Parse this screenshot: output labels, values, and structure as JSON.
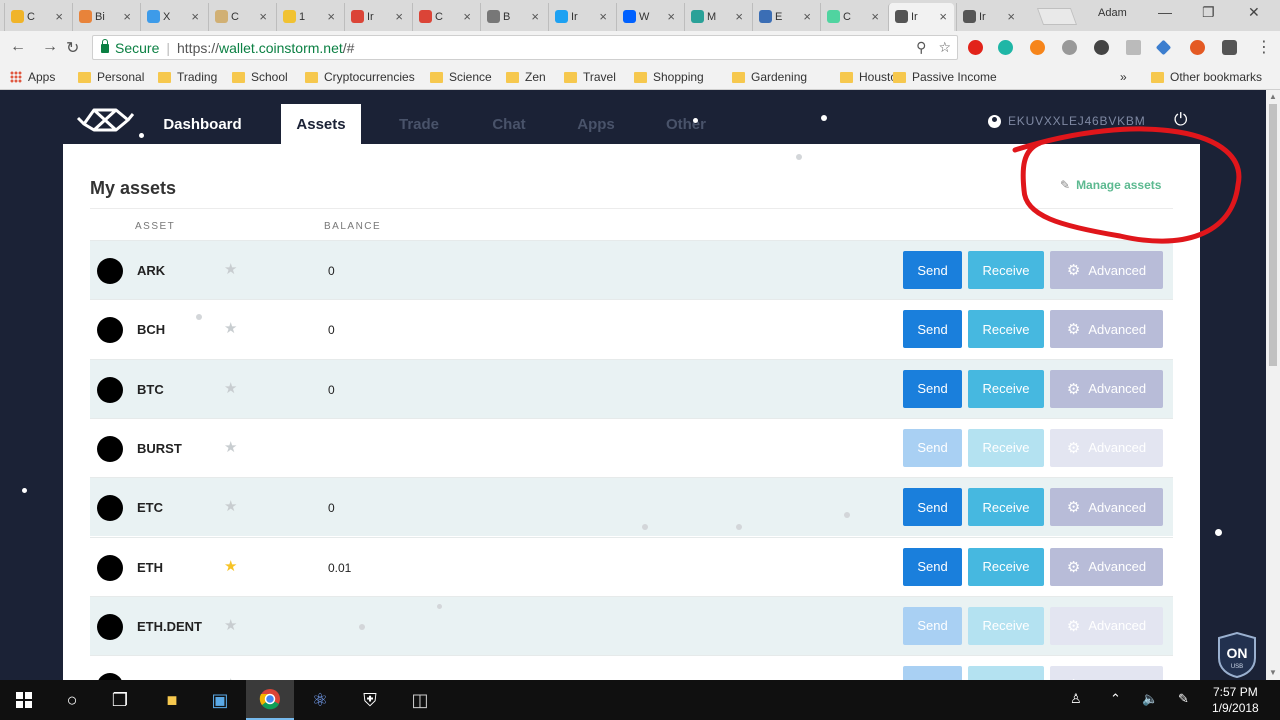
{
  "browser": {
    "tabs": [
      {
        "label": "C",
        "color": "#f0b429"
      },
      {
        "label": "Bi",
        "color": "#e8833a"
      },
      {
        "label": "X",
        "color": "#3d9be9"
      },
      {
        "label": "C",
        "color": "#d1b074"
      },
      {
        "label": "1",
        "color": "#f1c232"
      },
      {
        "label": "Ir",
        "color": "#db4437"
      },
      {
        "label": "C",
        "color": "#db4437"
      },
      {
        "label": "B",
        "color": "#777777"
      },
      {
        "label": "Ir",
        "color": "#1da1f2"
      },
      {
        "label": "W",
        "color": "#0061ff"
      },
      {
        "label": "M",
        "color": "#2aa198"
      },
      {
        "label": "E",
        "color": "#3b6eb5"
      },
      {
        "label": "C",
        "color": "#50d4a0"
      },
      {
        "label": "Ir",
        "color": "#555555"
      },
      {
        "label": "Ir",
        "color": "#555555"
      }
    ],
    "active_tab_index": 13,
    "profile_name": "Adam",
    "secure_label": "Secure",
    "url_scheme": "https://",
    "url_host": "wallet.coinstorm.net",
    "url_path": "/#",
    "bookmarks": [
      {
        "label": "Apps",
        "type": "apps"
      },
      {
        "label": "Personal",
        "type": "folder"
      },
      {
        "label": "Trading",
        "type": "folder"
      },
      {
        "label": "School",
        "type": "folder"
      },
      {
        "label": "Cryptocurrencies",
        "type": "folder"
      },
      {
        "label": "Science",
        "type": "folder"
      },
      {
        "label": "Zen",
        "type": "folder"
      },
      {
        "label": "Travel",
        "type": "folder"
      },
      {
        "label": "Shopping",
        "type": "folder"
      },
      {
        "label": "Gardening",
        "type": "folder"
      },
      {
        "label": "Houston",
        "type": "folder"
      },
      {
        "label": "Passive Income",
        "type": "folder"
      }
    ],
    "bookmarks_overflow": "»",
    "other_bookmarks": "Other bookmarks"
  },
  "app": {
    "nav": [
      {
        "label": "Dashboard",
        "state": "normal"
      },
      {
        "label": "Assets",
        "state": "active"
      },
      {
        "label": "Trade",
        "state": "dim"
      },
      {
        "label": "Chat",
        "state": "dim"
      },
      {
        "label": "Apps",
        "state": "dim"
      },
      {
        "label": "Other",
        "state": "dim"
      }
    ],
    "account_id": "EKUVXXLEJ46BVKBM",
    "card_title": "My assets",
    "manage_assets": "Manage assets",
    "col_asset": "ASSET",
    "col_balance": "BALANCE",
    "btn_send": "Send",
    "btn_receive": "Receive",
    "btn_advanced": "Advanced",
    "assets": [
      {
        "symbol": "ARK",
        "balance": "0",
        "favorite": false,
        "enabled": true
      },
      {
        "symbol": "BCH",
        "balance": "0",
        "favorite": false,
        "enabled": true
      },
      {
        "symbol": "BTC",
        "balance": "0",
        "favorite": false,
        "enabled": true
      },
      {
        "symbol": "BURST",
        "balance": "",
        "favorite": false,
        "enabled": false
      },
      {
        "symbol": "ETC",
        "balance": "0",
        "favorite": false,
        "enabled": true
      },
      {
        "symbol": "ETH",
        "balance": "0.01",
        "favorite": true,
        "enabled": true
      },
      {
        "symbol": "ETH.DENT",
        "balance": "",
        "favorite": false,
        "enabled": false
      },
      {
        "symbol": "",
        "balance": "",
        "favorite": false,
        "enabled": false
      }
    ]
  },
  "shield_label": "ON",
  "shield_sub": "USB",
  "taskbar": {
    "time": "7:57 PM",
    "date": "1/9/2018"
  },
  "colors": {
    "page_bg": "#1b2236",
    "send": "#1a7fdc",
    "receive": "#46b8e0",
    "advanced": "#b8bcd8",
    "manage": "#5cb990",
    "annotation": "#e0161b"
  }
}
